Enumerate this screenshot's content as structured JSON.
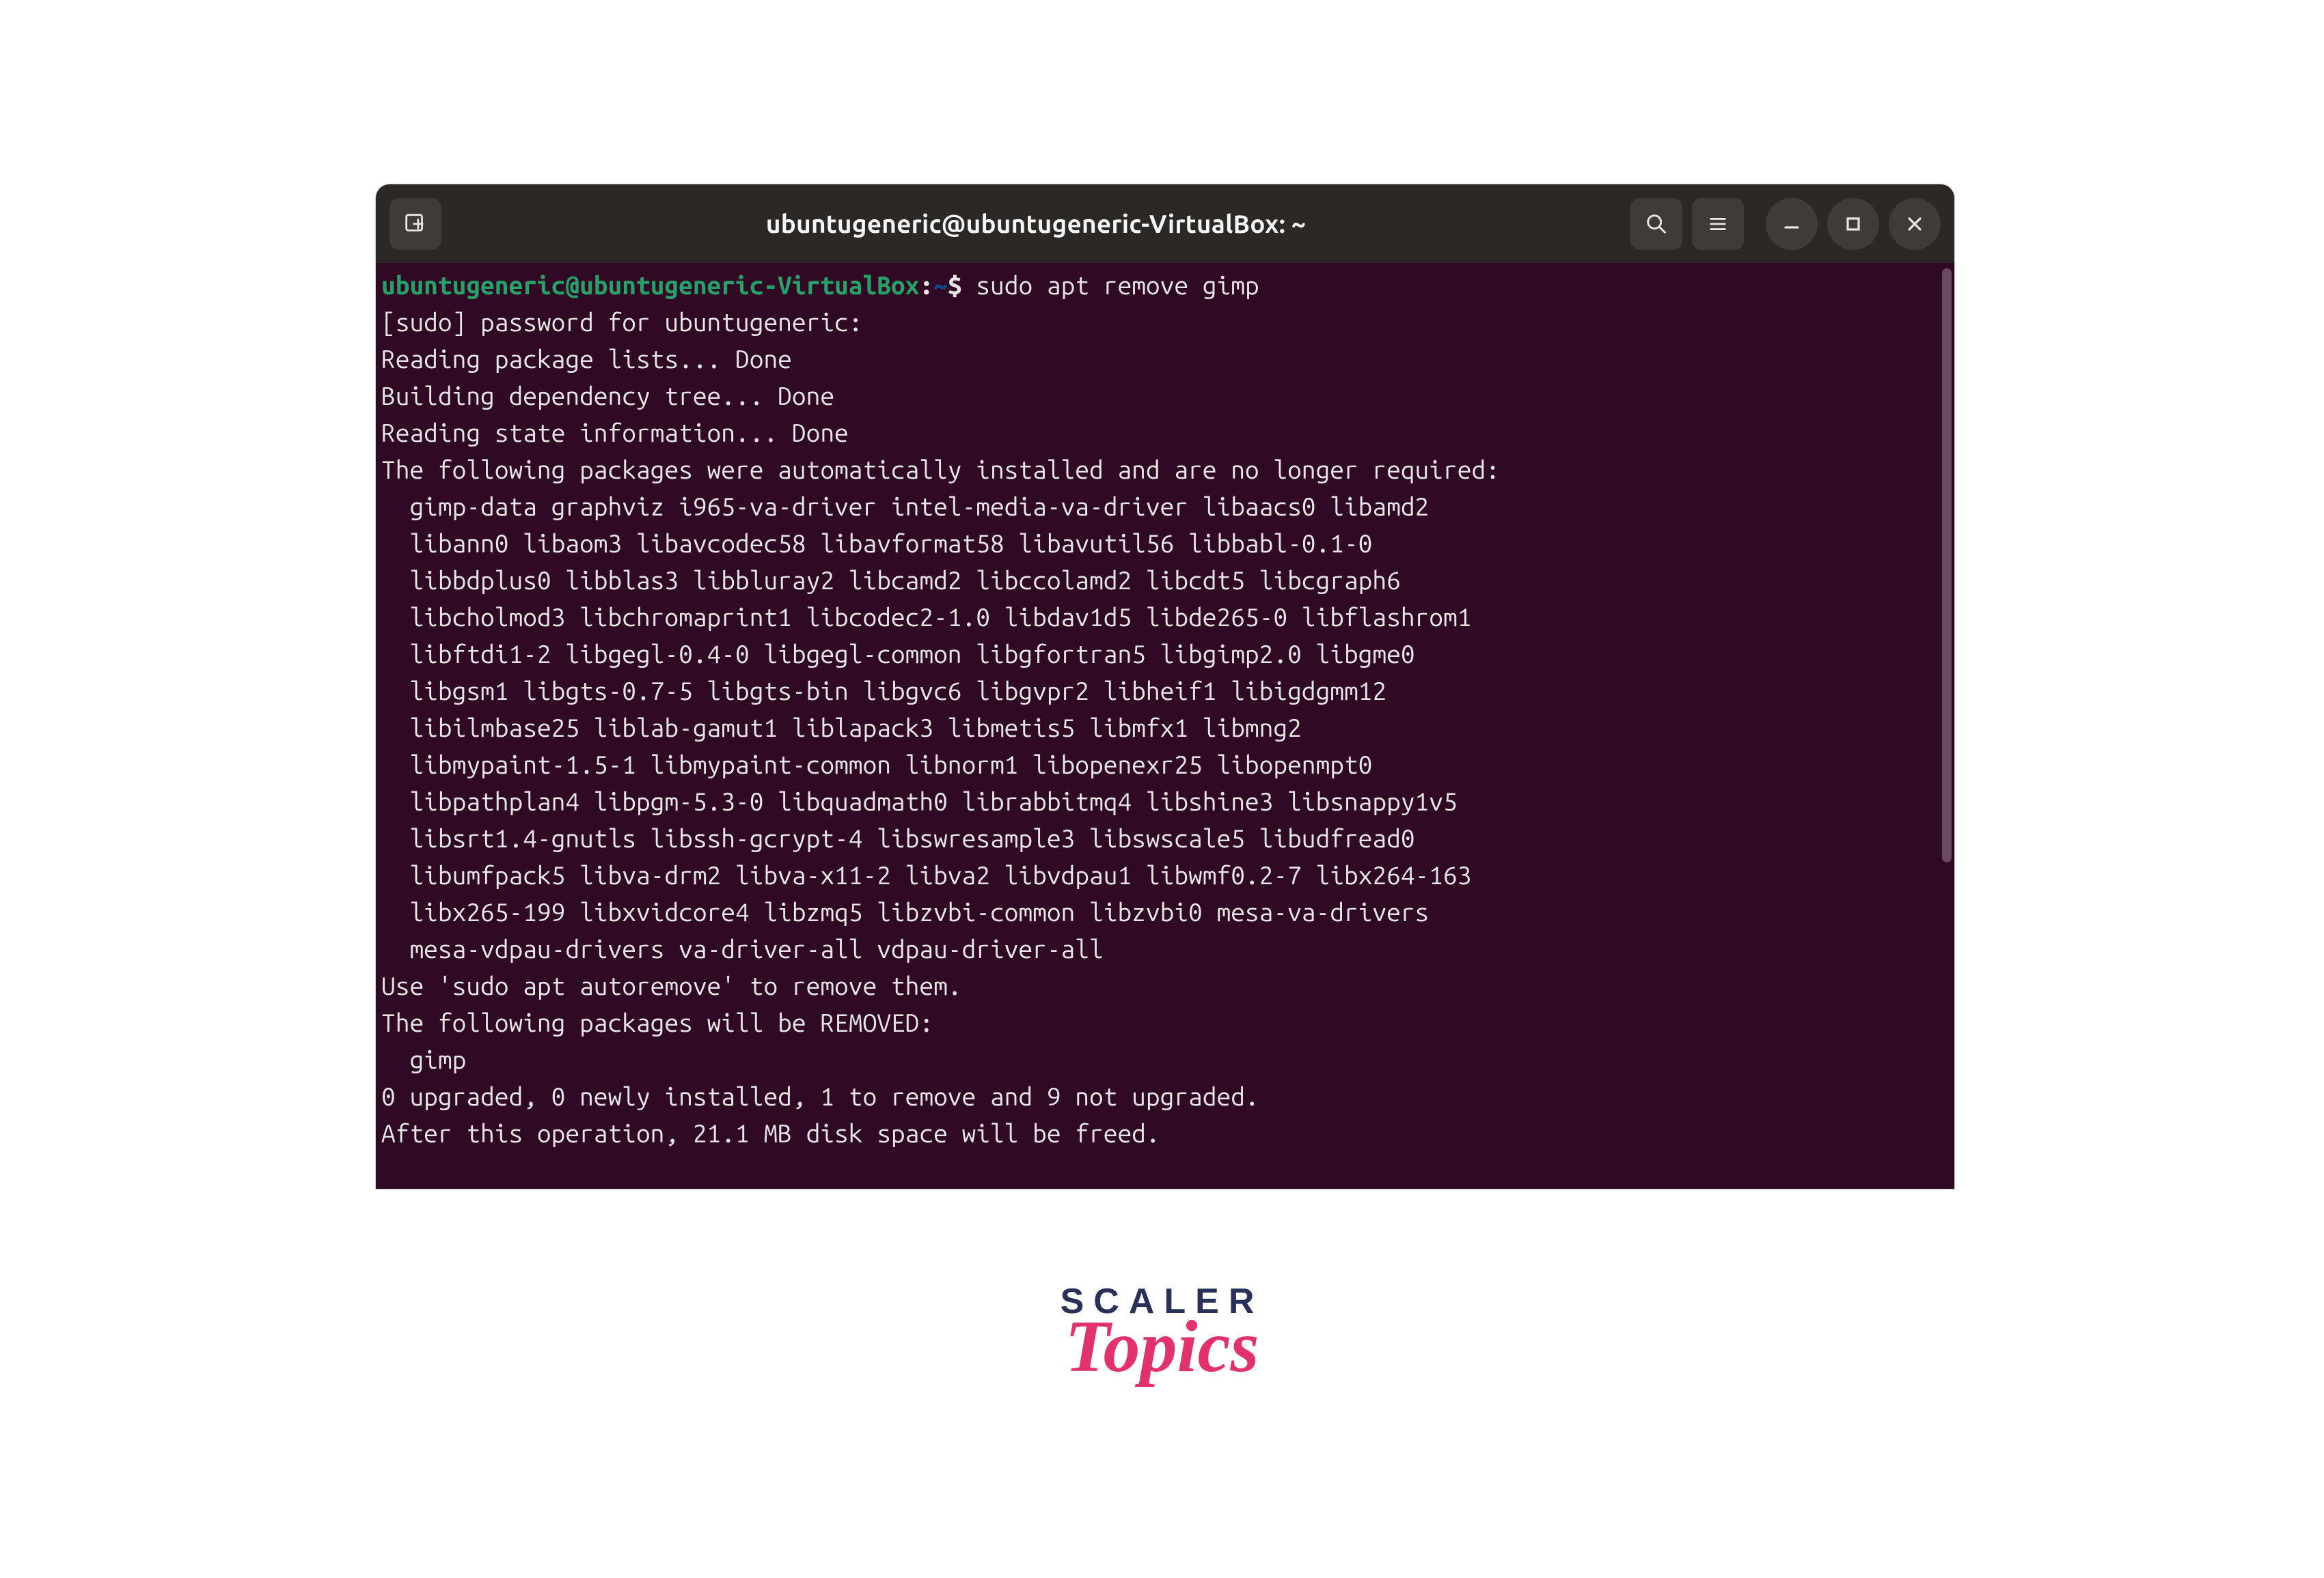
{
  "window": {
    "title": "ubuntugeneric@ubuntugeneric-VirtualBox: ~"
  },
  "prompt": {
    "user_host": "ubuntugeneric@ubuntugeneric-VirtualBox",
    "colon": ":",
    "path": "~",
    "dollar": "$ ",
    "command": "sudo apt remove gimp"
  },
  "lines": {
    "l01": "[sudo] password for ubuntugeneric:",
    "l02": "Reading package lists... Done",
    "l03": "Building dependency tree... Done",
    "l04": "Reading state information... Done",
    "l05": "The following packages were automatically installed and are no longer required:",
    "l06": "  gimp-data graphviz i965-va-driver intel-media-va-driver libaacs0 libamd2",
    "l07": "  libann0 libaom3 libavcodec58 libavformat58 libavutil56 libbabl-0.1-0",
    "l08": "  libbdplus0 libblas3 libbluray2 libcamd2 libccolamd2 libcdt5 libcgraph6",
    "l09": "  libcholmod3 libchromaprint1 libcodec2-1.0 libdav1d5 libde265-0 libflashrom1",
    "l10": "  libftdi1-2 libgegl-0.4-0 libgegl-common libgfortran5 libgimp2.0 libgme0",
    "l11": "  libgsm1 libgts-0.7-5 libgts-bin libgvc6 libgvpr2 libheif1 libigdgmm12",
    "l12": "  libilmbase25 liblab-gamut1 liblapack3 libmetis5 libmfx1 libmng2",
    "l13": "  libmypaint-1.5-1 libmypaint-common libnorm1 libopenexr25 libopenmpt0",
    "l14": "  libpathplan4 libpgm-5.3-0 libquadmath0 librabbitmq4 libshine3 libsnappy1v5",
    "l15": "  libsrt1.4-gnutls libssh-gcrypt-4 libswresample3 libswscale5 libudfread0",
    "l16": "  libumfpack5 libva-drm2 libva-x11-2 libva2 libvdpau1 libwmf0.2-7 libx264-163",
    "l17": "  libx265-199 libxvidcore4 libzmq5 libzvbi-common libzvbi0 mesa-va-drivers",
    "l18": "  mesa-vdpau-drivers va-driver-all vdpau-driver-all",
    "l19": "Use 'sudo apt autoremove' to remove them.",
    "l20": "The following packages will be REMOVED:",
    "l21": "  gimp",
    "l22": "0 upgraded, 0 newly installed, 1 to remove and 9 not upgraded.",
    "l23": "After this operation, 21.1 MB disk space will be freed."
  },
  "watermark": {
    "top": "SCALER",
    "bottom": "Topics"
  }
}
